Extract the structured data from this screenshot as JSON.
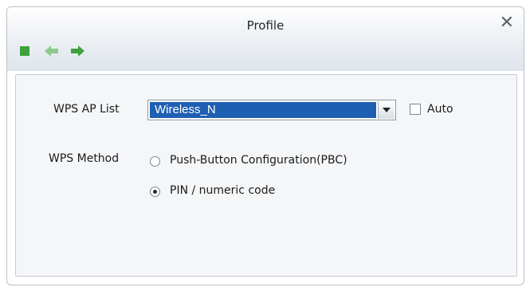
{
  "window": {
    "title": "Profile"
  },
  "form": {
    "ap_list_label": "WPS AP List",
    "ap_list_value": "Wireless_N",
    "auto_label": "Auto",
    "method_label": "WPS Method",
    "options": [
      {
        "label": "Push-Button Configuration(PBC)",
        "selected": false
      },
      {
        "label": "PIN / numeric code",
        "selected": true
      }
    ]
  },
  "colors": {
    "accent": "#1f5fb3",
    "toolbar_green": "#3ea13b",
    "arrow_dim": "#8fc98b"
  }
}
